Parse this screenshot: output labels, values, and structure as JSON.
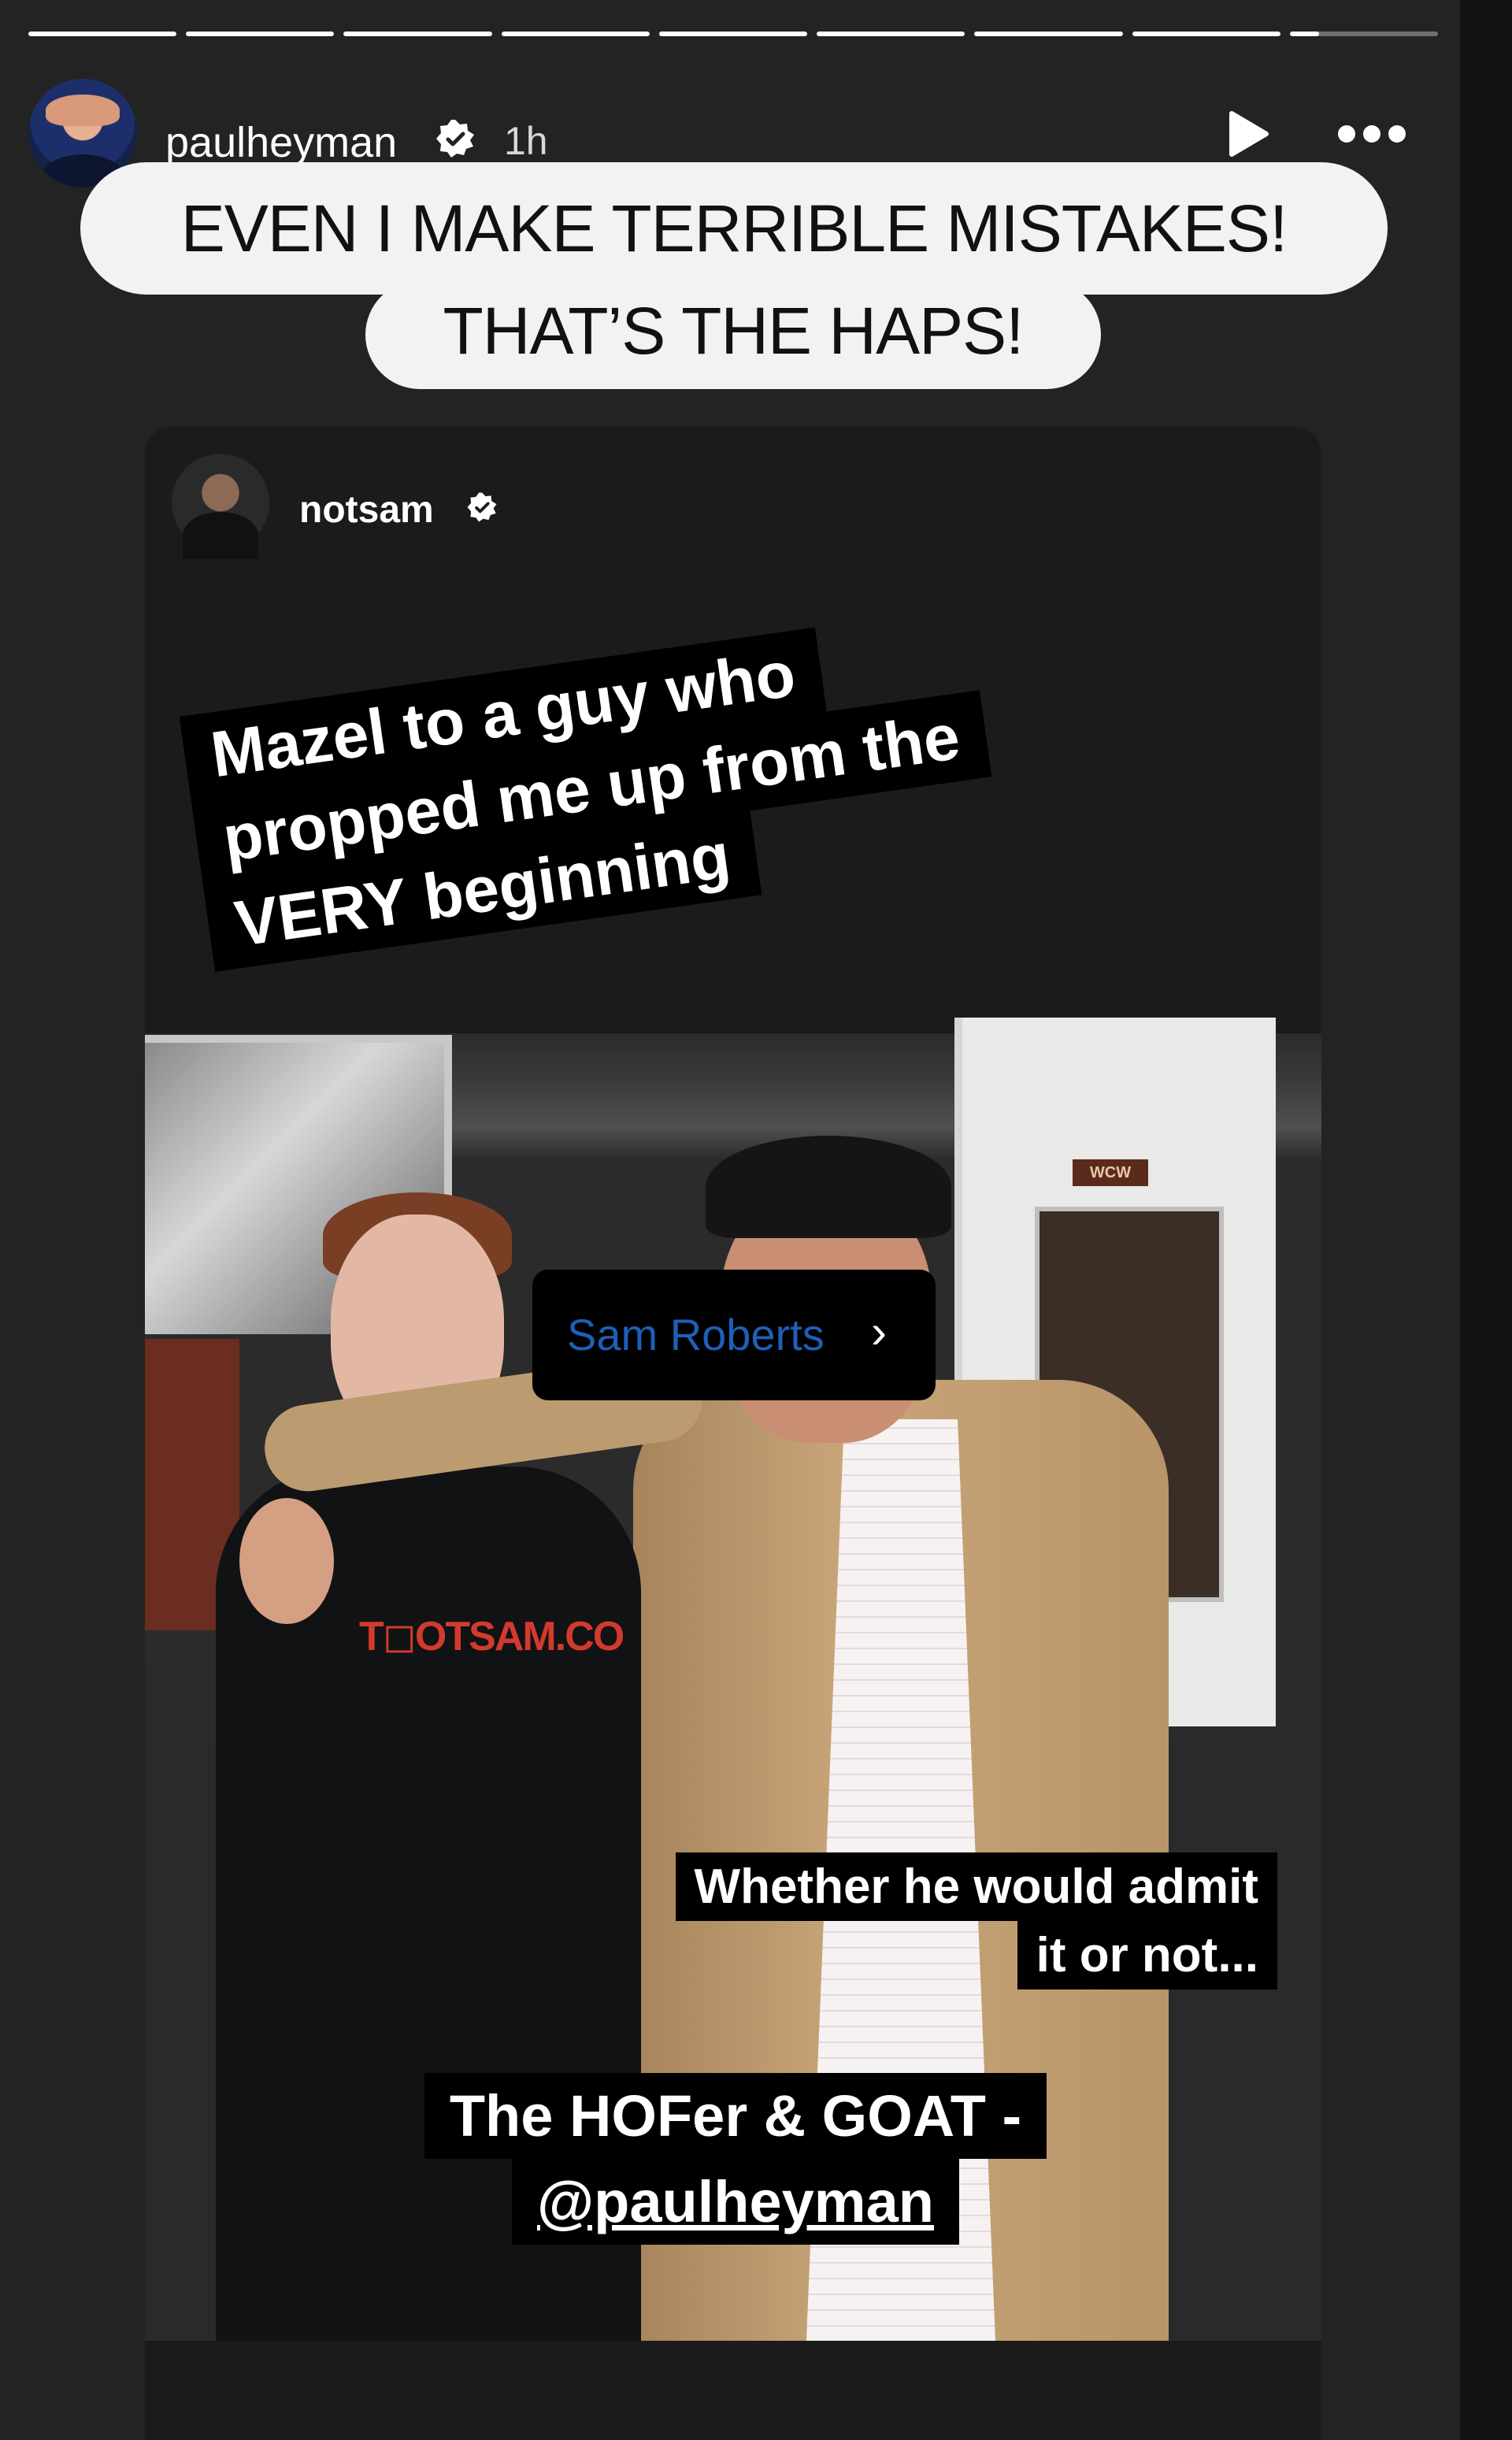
{
  "progress": {
    "segments": 9,
    "current_index": 8,
    "current_fraction": 0.2
  },
  "author": {
    "username": "paulheyman",
    "time": "1h"
  },
  "headline": {
    "line1": "EVEN I MAKE TERRIBLE MISTAKES!",
    "line2": "THAT’S THE HAPS!"
  },
  "shared_post": {
    "username": "notsam",
    "caption_lines": [
      "Mazel to a guy who",
      "propped me up from the",
      "VERY beginning"
    ],
    "tag_label": "Sam Roberts",
    "tag_chevron": "›",
    "small_caption": [
      "Whether he would admit",
      "it or not..."
    ],
    "bottom_caption": {
      "line1": "The HOFer & GOAT -",
      "line2": "@paulheyman"
    },
    "shirt_text": "T◻OTSAM.CO",
    "door_sign": "WCW"
  },
  "icons": {
    "verified": "verified-badge-icon",
    "play": "play-icon",
    "more": "more-icon",
    "chevron": "chevron-right-icon"
  },
  "colors": {
    "background": "#232323",
    "caption_bg": "#000000",
    "tag_text": "#1e5fb8"
  }
}
